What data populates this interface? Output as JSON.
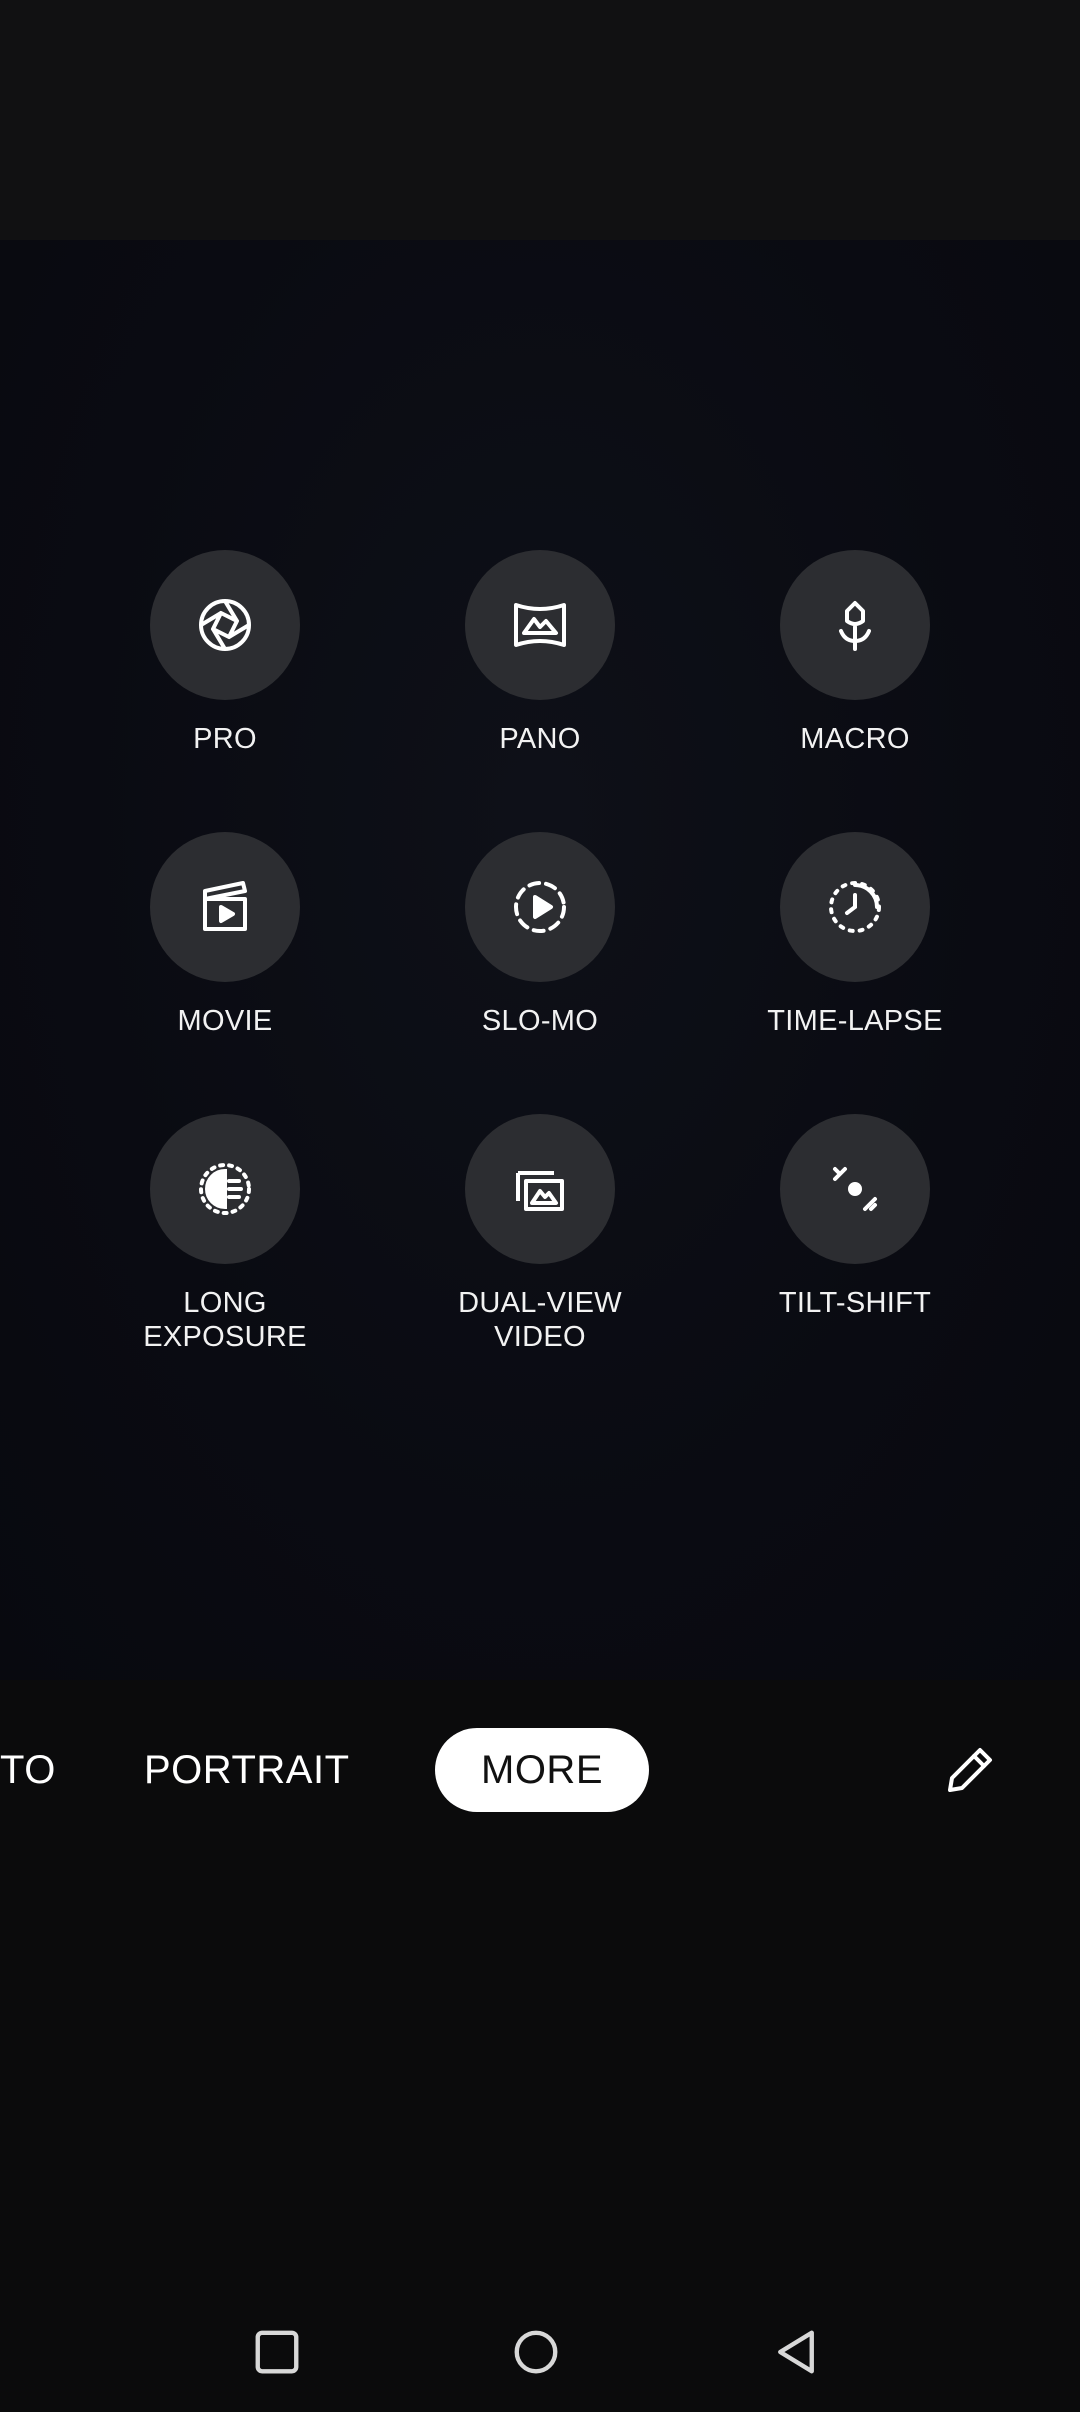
{
  "modes": [
    {
      "id": "pro",
      "label": "PRO",
      "icon": "aperture-icon"
    },
    {
      "id": "pano",
      "label": "PANO",
      "icon": "panorama-icon"
    },
    {
      "id": "macro",
      "label": "MACRO",
      "icon": "flower-icon"
    },
    {
      "id": "movie",
      "label": "MOVIE",
      "icon": "clapperboard-icon"
    },
    {
      "id": "slo-mo",
      "label": "SLO-MO",
      "icon": "slow-motion-icon"
    },
    {
      "id": "time-lapse",
      "label": "TIME-LAPSE",
      "icon": "time-lapse-icon"
    },
    {
      "id": "long-exposure",
      "label": "LONG\nEXPOSURE",
      "icon": "long-exposure-icon"
    },
    {
      "id": "dual-view",
      "label": "DUAL-VIEW\nVIDEO",
      "icon": "dual-view-icon"
    },
    {
      "id": "tilt-shift",
      "label": "TILT-SHIFT",
      "icon": "tilt-shift-icon"
    }
  ],
  "mode_bar": {
    "tabs": [
      "TO",
      "PORTRAIT",
      "MORE"
    ],
    "active": "MORE"
  },
  "nav": {
    "recents_icon": "square-icon",
    "home_icon": "circle-icon",
    "back_icon": "triangle-back-icon"
  },
  "colors": {
    "background": "#0b0b0c",
    "mode_button": "#2c2d31",
    "active_pill": "#ffffff"
  }
}
